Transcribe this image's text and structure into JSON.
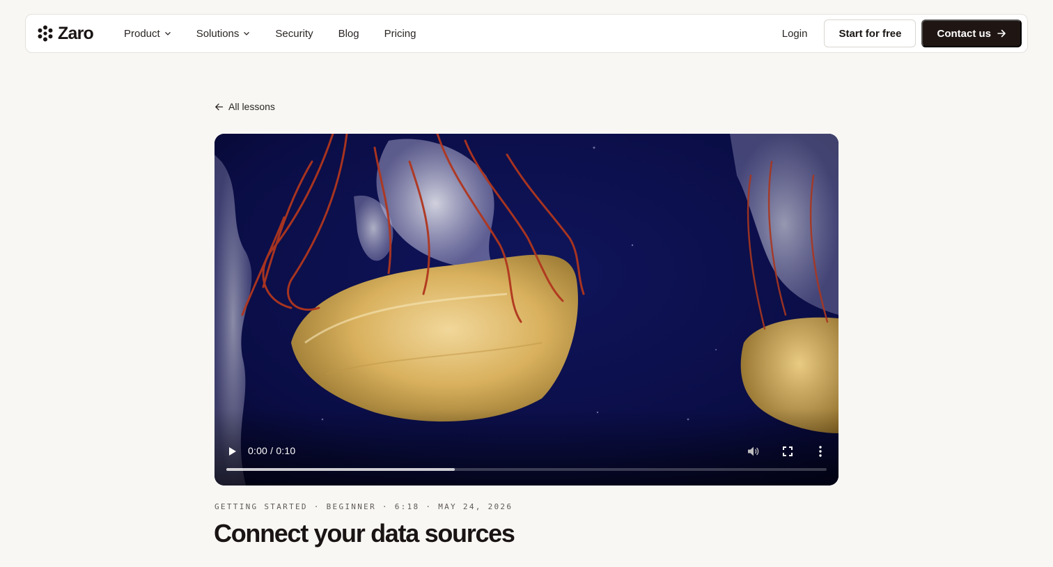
{
  "brand": {
    "name": "Zaro"
  },
  "nav": {
    "items": [
      {
        "label": "Product",
        "dropdown": true
      },
      {
        "label": "Solutions",
        "dropdown": true
      },
      {
        "label": "Security"
      },
      {
        "label": "Blog"
      },
      {
        "label": "Pricing"
      }
    ],
    "login_label": "Login",
    "start_label": "Start for free",
    "contact_label": "Contact us"
  },
  "back_link": {
    "label": "All lessons"
  },
  "video": {
    "time_display": "0:00 / 0:10",
    "progress_fraction": 0.38,
    "icons": [
      "play-icon",
      "volume-icon",
      "fullscreen-icon",
      "more-options-icon"
    ]
  },
  "lesson": {
    "meta": "GETTING STARTED · BEGINNER · 6:18 · MAY 24, 2026",
    "title": "Connect your data sources"
  },
  "colors": {
    "page_bg": "#f8f7f4",
    "accent_dark": "#1f1513",
    "video_bg": "#0a0c3f"
  }
}
